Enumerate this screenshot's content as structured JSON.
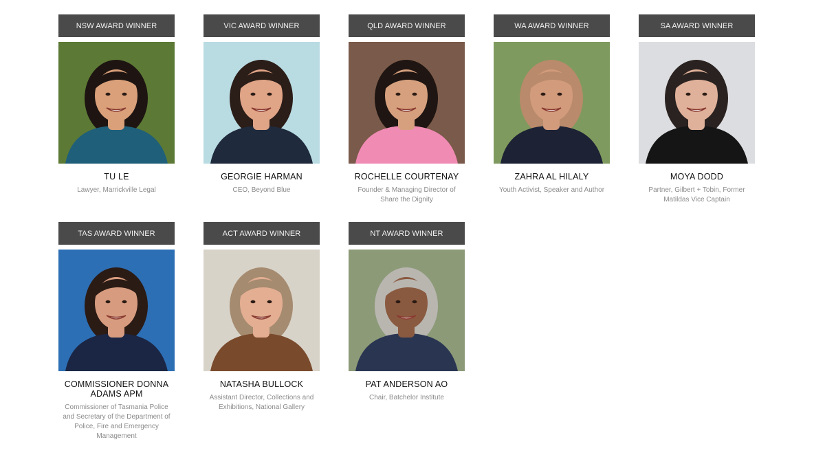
{
  "winners": [
    {
      "badge": "NSW AWARD WINNER",
      "name": "TU LE",
      "role": "Lawyer, Marrickville Legal",
      "colors": {
        "bg": "#5c7a35",
        "skin": "#d9a07a",
        "hair": "#1e1512",
        "top": "#1f5f7a"
      }
    },
    {
      "badge": "VIC AWARD WINNER",
      "name": "GEORGIE HARMAN",
      "role": "CEO, Beyond Blue",
      "colors": {
        "bg": "#b9dbe2",
        "skin": "#e0a487",
        "hair": "#2b1d18",
        "top": "#1f2a3c"
      }
    },
    {
      "badge": "QLD AWARD WINNER",
      "name": "ROCHELLE COURTENAY",
      "role": "Founder & Managing Director of Share the Dignity",
      "colors": {
        "bg": "#7a5a4a",
        "skin": "#d6a07e",
        "hair": "#1f1512",
        "top": "#f08bb4"
      }
    },
    {
      "badge": "WA AWARD WINNER",
      "name": "ZAHRA AL HILALY",
      "role": "Youth Activist, Speaker and Author",
      "colors": {
        "bg": "#7f9a5e",
        "skin": "#d19b7c",
        "hair": "#b98a6b",
        "top": "#1d2235"
      }
    },
    {
      "badge": "SA AWARD WINNER",
      "name": "MOYA DODD",
      "role": "Partner, Gilbert + Tobin, Former Matildas Vice Captain",
      "colors": {
        "bg": "#dcdde0",
        "skin": "#e0b19a",
        "hair": "#2a2220",
        "top": "#151515"
      }
    },
    {
      "badge": "TAS AWARD WINNER",
      "name": "COMMISSIONER DONNA ADAMS APM",
      "role": "Commissioner of Tasmania Police and Secretary of the Department of Police, Fire and Emergency Management",
      "colors": {
        "bg": "#2d6fb5",
        "skin": "#d79c7f",
        "hair": "#2b1b15",
        "top": "#1b2644"
      }
    },
    {
      "badge": "ACT AWARD WINNER",
      "name": "NATASHA BULLOCK",
      "role": "Assistant Director, Collections and Exhibitions, National Gallery",
      "colors": {
        "bg": "#d8d3c8",
        "skin": "#e3ae92",
        "hair": "#a58b70",
        "top": "#7a4a2c"
      }
    },
    {
      "badge": "NT AWARD WINNER",
      "name": "PAT ANDERSON AO",
      "role": "Chair, Batchelor Institute",
      "colors": {
        "bg": "#8c9a78",
        "skin": "#8a5a40",
        "hair": "#b9b6b0",
        "top": "#2a3552"
      }
    }
  ]
}
